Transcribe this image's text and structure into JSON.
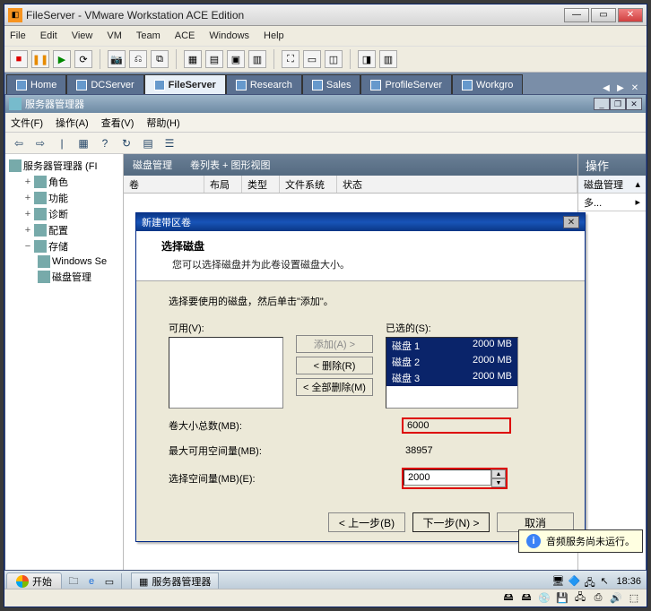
{
  "vmware": {
    "title": "FileServer - VMware Workstation ACE Edition",
    "menu": [
      "File",
      "Edit",
      "View",
      "VM",
      "Team",
      "ACE",
      "Windows",
      "Help"
    ],
    "tabs": [
      {
        "label": "Home",
        "active": false
      },
      {
        "label": "DCServer",
        "active": false
      },
      {
        "label": "FileServer",
        "active": true
      },
      {
        "label": "Research",
        "active": false
      },
      {
        "label": "Sales",
        "active": false
      },
      {
        "label": "ProfileServer",
        "active": false
      },
      {
        "label": "Workgro",
        "active": false
      }
    ]
  },
  "servermgr": {
    "title": "服务器管理器",
    "menu": [
      "文件(F)",
      "操作(A)",
      "查看(V)",
      "帮助(H)"
    ],
    "tree": {
      "root": "服务器管理器 (FI",
      "items": [
        "角色",
        "功能",
        "诊断",
        "配置",
        "存储"
      ],
      "storage_children": [
        "Windows Se",
        "磁盘管理"
      ]
    },
    "center": {
      "title": "磁盘管理",
      "subtitle": "卷列表 + 图形视图",
      "cols": [
        "卷",
        "布局",
        "类型",
        "文件系统",
        "状态"
      ]
    },
    "actions": {
      "title": "操作",
      "sub": "磁盘管理",
      "more": "多..."
    }
  },
  "dialog": {
    "title": "新建带区卷",
    "heading": "选择磁盘",
    "subhead": "您可以选择磁盘并为此卷设置磁盘大小。",
    "hint": "选择要使用的磁盘，然后单击\"添加\"。",
    "available_label": "可用(V):",
    "selected_label": "已选的(S):",
    "buttons": {
      "add": "添加(A) >",
      "remove": "< 删除(R)",
      "remove_all": "< 全部删除(M)"
    },
    "selected": [
      {
        "name": "磁盘 1",
        "size": "2000 MB"
      },
      {
        "name": "磁盘 2",
        "size": "2000 MB"
      },
      {
        "name": "磁盘 3",
        "size": "2000 MB"
      }
    ],
    "total_label": "卷大小总数(MB):",
    "total_value": "6000",
    "max_label": "最大可用空间量(MB):",
    "max_value": "38957",
    "select_label": "选择空间量(MB)(E):",
    "select_value": "2000",
    "nav": {
      "back": "< 上一步(B)",
      "next": "下一步(N) >",
      "cancel": "取消"
    }
  },
  "taskbar": {
    "start": "开始",
    "task": "服务器管理器",
    "clock": "18:36"
  },
  "balloon": {
    "text": "音频服务尚未运行。"
  }
}
